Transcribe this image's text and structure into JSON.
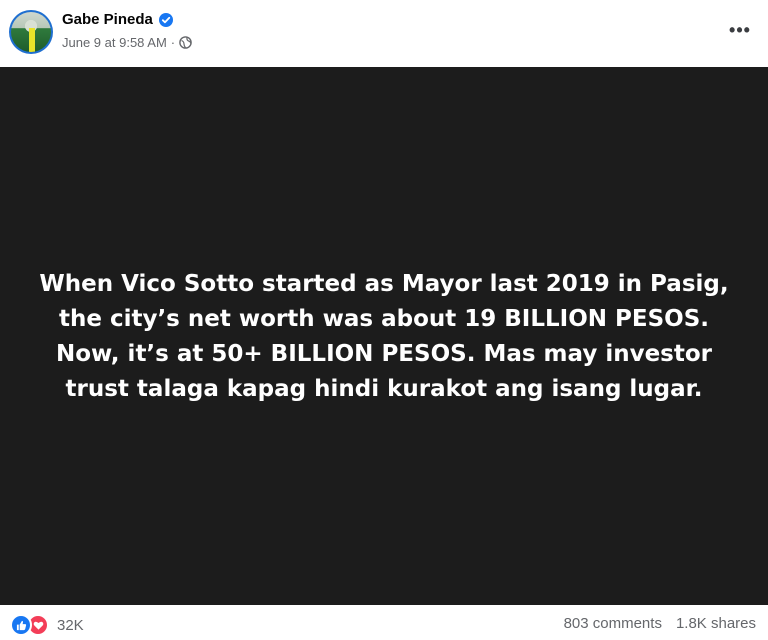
{
  "post": {
    "author": "Gabe Pineda",
    "timestamp": "June 9 at 9:58 AM",
    "separator": "·",
    "privacy_icon": "globe-icon",
    "more_label": "•••"
  },
  "content": {
    "text": "When Vico Sotto started as Mayor last 2019 in Pasig, the city’s net worth was about 19 BILLION PESOS. Now, it’s at 50+ BILLION PESOS. Mas may investor trust talaga kapag hindi kurakot ang isang lugar.",
    "background": "#1c1c1c",
    "text_color": "#ffffff"
  },
  "footer": {
    "reaction_icons": [
      "like-icon",
      "love-icon"
    ],
    "reaction_count": "32K",
    "comments": "803 comments",
    "shares": "1.8K shares"
  },
  "colors": {
    "accent": "#1877f2",
    "love": "#f33e58",
    "secondary_text": "#65676b"
  }
}
